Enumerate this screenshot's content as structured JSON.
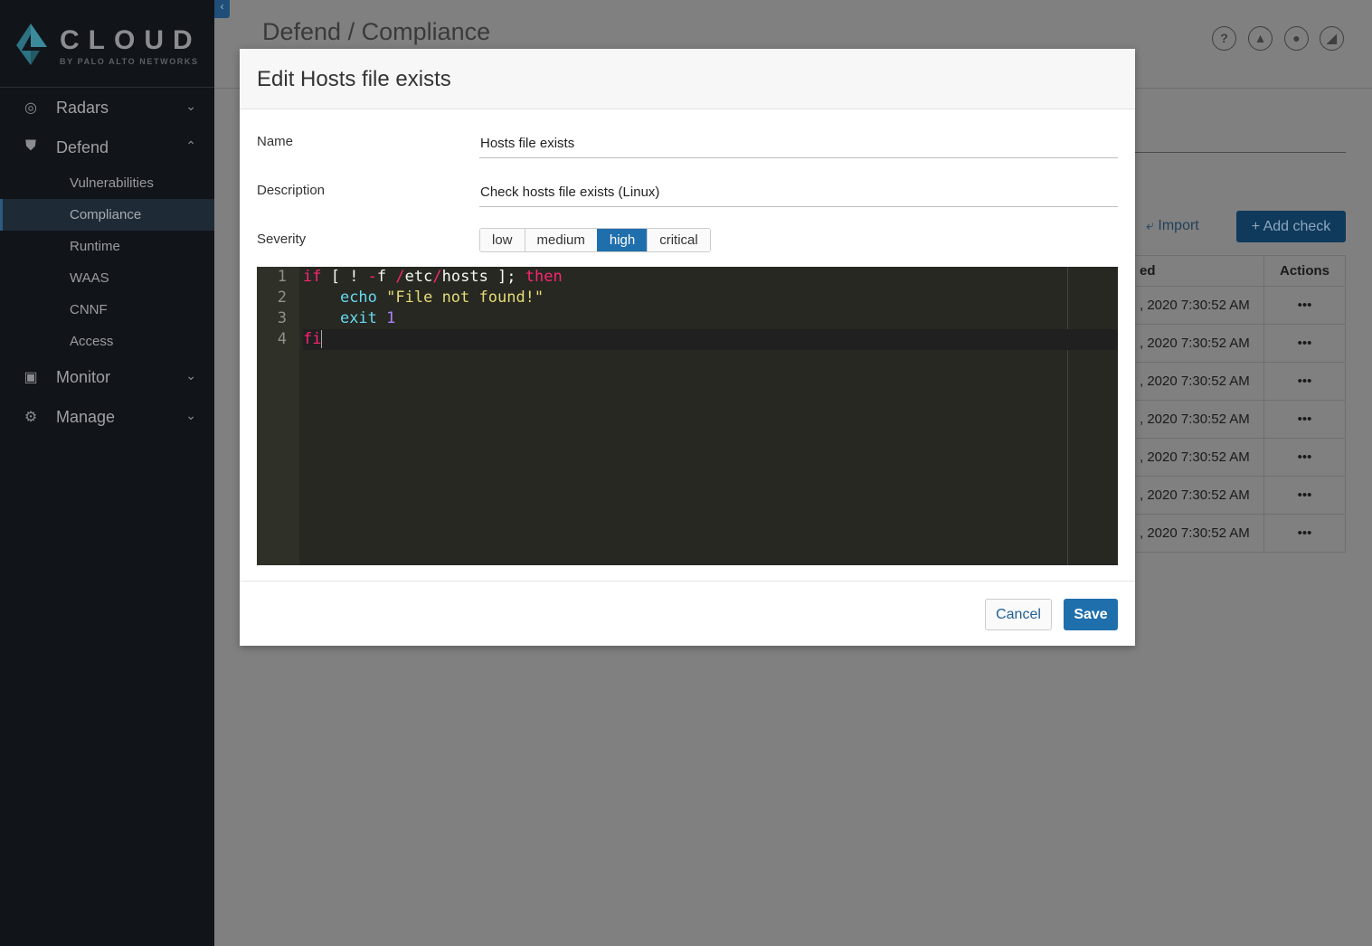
{
  "sidebar": {
    "logo": {
      "word": "CLOUD",
      "sub": "BY PALO ALTO NETWORKS"
    },
    "items": [
      {
        "label": "Radars",
        "icon": "radar-icon",
        "expanded": false
      },
      {
        "label": "Defend",
        "icon": "shield-icon",
        "expanded": true
      },
      {
        "label": "Monitor",
        "icon": "monitor-icon",
        "expanded": false
      },
      {
        "label": "Manage",
        "icon": "gear-icon",
        "expanded": false
      }
    ],
    "defend_sub": [
      "Vulnerabilities",
      "Compliance",
      "Runtime",
      "WAAS",
      "CNNF",
      "Access"
    ],
    "active": "Compliance"
  },
  "header": {
    "title": "Defend / Compliance",
    "icons": [
      "help-icon",
      "bell-icon",
      "user-icon",
      "signal-icon"
    ]
  },
  "toolbar": {
    "import": "Import",
    "add_check": "+ Add check"
  },
  "table": {
    "headers": [
      "ed",
      "Actions"
    ],
    "rows": [
      ", 2020 7:30:52 AM",
      ", 2020 7:30:52 AM",
      ", 2020 7:30:52 AM",
      ", 2020 7:30:52 AM",
      ", 2020 7:30:52 AM",
      ", 2020 7:30:52 AM",
      ", 2020 7:30:52 AM"
    ],
    "action": "•••"
  },
  "modal": {
    "title": "Edit Hosts file exists",
    "name_label": "Name",
    "name_value": "Hosts file exists",
    "desc_label": "Description",
    "desc_value": "Check hosts file exists (Linux)",
    "severity_label": "Severity",
    "severity_options": [
      "low",
      "medium",
      "high",
      "critical"
    ],
    "severity_selected": "high",
    "code_lines": [
      "if [ ! -f /etc/hosts ]; then",
      "    echo \"File not found!\"",
      "    exit 1",
      "fi"
    ],
    "cancel": "Cancel",
    "save": "Save"
  },
  "colors": {
    "accent": "#1f6fad",
    "sidebar": "#111419",
    "editor": "#272822"
  }
}
